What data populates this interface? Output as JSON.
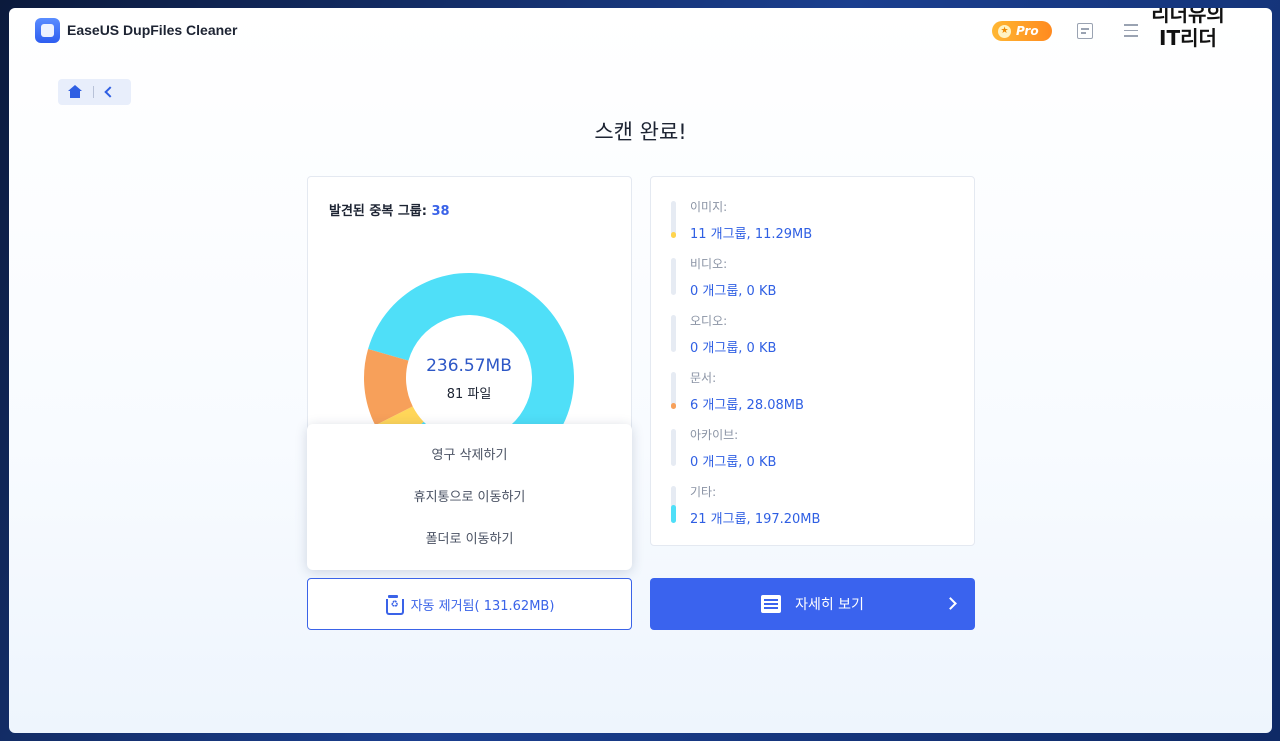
{
  "app": {
    "title": "EaseUS DupFiles Cleaner",
    "pro_label": "Pro",
    "overlay_logo": "리더유의 IT리더"
  },
  "page": {
    "heading": "스캔 완료!"
  },
  "summary": {
    "groups_label": "발견된 중복 그룹: ",
    "groups_count": "38",
    "total_size": "236.57MB",
    "total_files": "81 파일"
  },
  "donut": {
    "segments": [
      {
        "key": "other",
        "value": 197.2,
        "color": "#4fdff8"
      },
      {
        "key": "image",
        "value": 11.29,
        "color": "#ffd659"
      },
      {
        "key": "document",
        "value": 28.08,
        "color": "#f7a05a"
      }
    ]
  },
  "dropdown": {
    "items": [
      "영구 삭제하기",
      "휴지통으로 이동하기",
      "폴더로 이동하기"
    ]
  },
  "categories": [
    {
      "name": "이미지:",
      "value": "11 개그룹, 11.29MB",
      "color": "#ffd44d",
      "fraction": 0.12
    },
    {
      "name": "비디오:",
      "value": "0 개그룹, 0 KB",
      "color": "#e6ebf3",
      "fraction": 0
    },
    {
      "name": "오디오:",
      "value": "0 개그룹, 0 KB",
      "color": "#e6ebf3",
      "fraction": 0
    },
    {
      "name": "문서:",
      "value": "6 개그룹, 28.08MB",
      "color": "#f7a05a",
      "fraction": 0.1
    },
    {
      "name": "아카이브:",
      "value": "0 개그룹, 0 KB",
      "color": "#e6ebf3",
      "fraction": 0
    },
    {
      "name": "기타:",
      "value": "21 개그룹, 197.20MB",
      "color": "#4fdff8",
      "fraction": 0.5
    }
  ],
  "buttons": {
    "auto_remove": "자동 제거됨( 131.62MB)",
    "view_details": "자세히 보기"
  }
}
